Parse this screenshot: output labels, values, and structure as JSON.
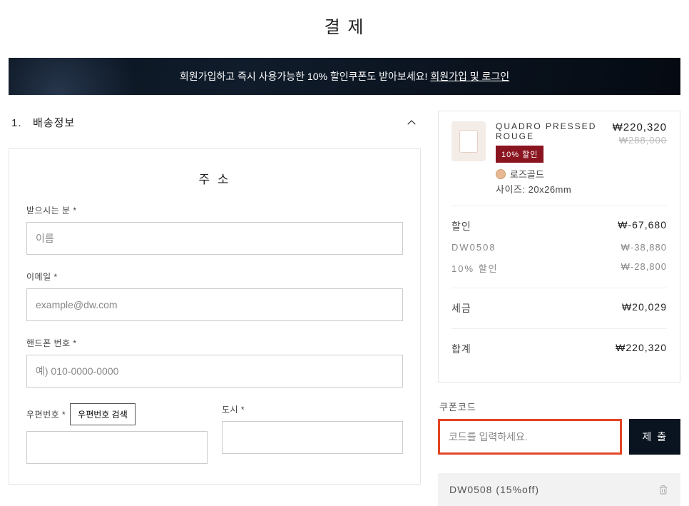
{
  "page_title": "결 제",
  "banner": {
    "text": "회원가입하고 즉시 사용가능한 10% 할인쿠폰도 받아보세요!",
    "login_link": "회원가입 및 로그인"
  },
  "section": {
    "number": "1.",
    "title": "배송정보"
  },
  "form": {
    "heading": "주 소",
    "name": {
      "label": "받으시는 분 *",
      "placeholder": "이름"
    },
    "email": {
      "label": "이메일 *",
      "placeholder": "example@dw.com"
    },
    "phone": {
      "label": "핸드폰 번호 *",
      "placeholder": "예) 010-0000-0000"
    },
    "zip": {
      "label": "우편번호 *",
      "search_btn": "우편번호 검색"
    },
    "city": {
      "label": "도시 *"
    }
  },
  "product": {
    "name": "QUADRO PRESSED ROUGE",
    "badge": "10% 할인",
    "color_label": "로즈골드",
    "size_prefix": "사이즈:",
    "size_value": "20x26mm",
    "price_now": "₩220,320",
    "price_old": "₩288,000"
  },
  "summary_lines": {
    "discount": {
      "label": "할인",
      "value": "₩-67,680"
    },
    "dw0508": {
      "label": "DW0508",
      "value": "₩-38,880"
    },
    "pct": {
      "label": "10% 할인",
      "value": "₩-28,800"
    },
    "tax": {
      "label": "세금",
      "value": "₩20,029"
    },
    "total": {
      "label": "합계",
      "value": "₩220,320"
    }
  },
  "coupon": {
    "title": "쿠폰코드",
    "placeholder": "코드를 입력하세요.",
    "submit": "제 출",
    "applied": "DW0508 (15%off)"
  }
}
